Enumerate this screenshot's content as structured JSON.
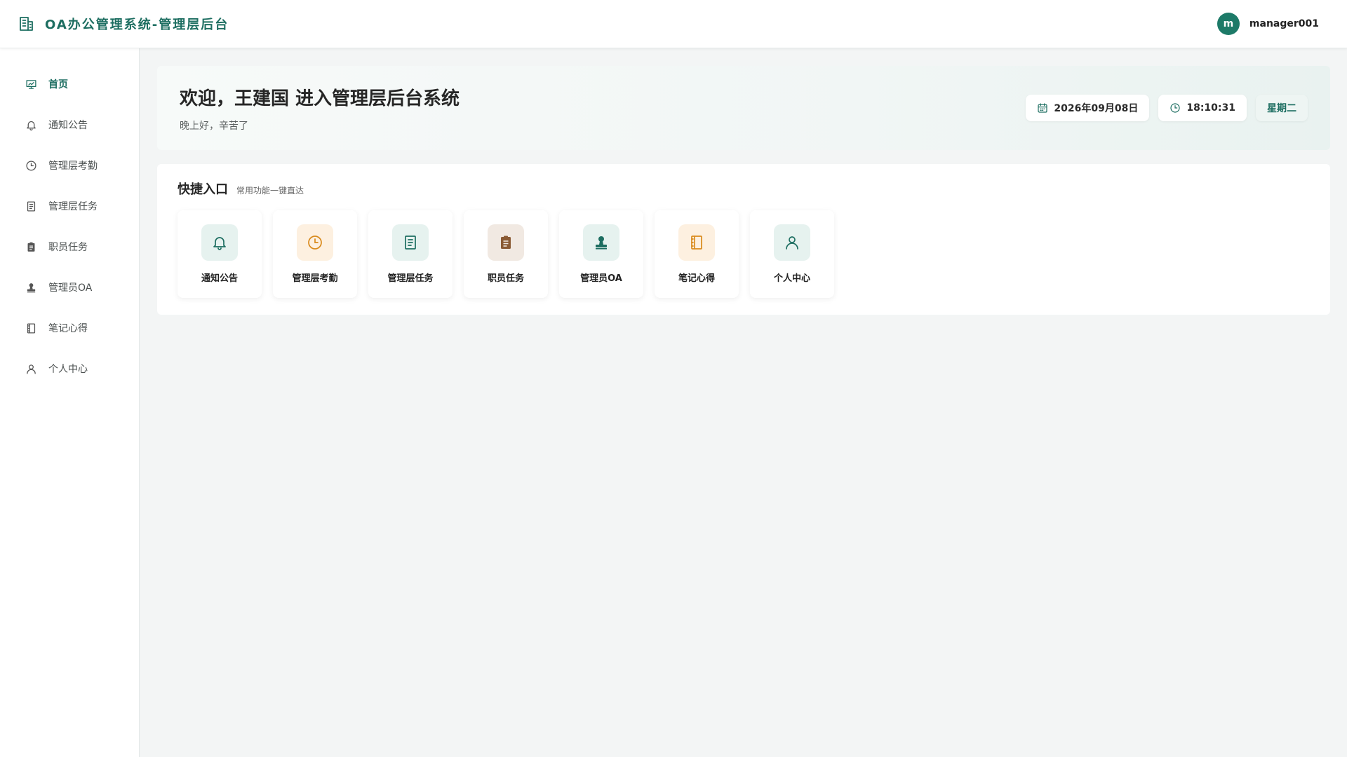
{
  "header": {
    "title": "OA办公管理系统-管理层后台",
    "logo_icon": "office-building-icon",
    "avatar_letter": "m",
    "username": "manager001"
  },
  "sidebar": {
    "items": [
      {
        "label": "首页",
        "icon": "dashboard-icon",
        "active": true
      },
      {
        "label": "通知公告",
        "icon": "bell-icon"
      },
      {
        "label": "管理层考勤",
        "icon": "clock-icon"
      },
      {
        "label": "管理层任务",
        "icon": "document-icon"
      },
      {
        "label": "职员任务",
        "icon": "clipboard-icon"
      },
      {
        "label": "管理员OA",
        "icon": "stamp-icon"
      },
      {
        "label": "笔记心得",
        "icon": "notebook-icon"
      },
      {
        "label": "个人中心",
        "icon": "user-icon"
      }
    ]
  },
  "welcome": {
    "title": "欢迎，王建国 进入管理层后台系统",
    "subtitle": "晚上好，辛苦了",
    "date": "2026年09月08日",
    "time": "18:10:31",
    "weekday": "星期二"
  },
  "quick": {
    "title": "快捷入口",
    "subtitle": "常用功能一键直达",
    "tiles": [
      {
        "label": "通知公告",
        "icon": "bell-icon"
      },
      {
        "label": "管理层考勤",
        "icon": "clock-icon"
      },
      {
        "label": "管理层任务",
        "icon": "document-icon"
      },
      {
        "label": "职员任务",
        "icon": "clipboard-icon"
      },
      {
        "label": "管理员OA",
        "icon": "stamp-icon"
      },
      {
        "label": "笔记心得",
        "icon": "notebook-icon"
      },
      {
        "label": "个人中心",
        "icon": "user-icon"
      }
    ]
  },
  "colors": {
    "brand": "#1d6e61",
    "accent_orange": "#d98a1c",
    "accent_brown": "#8a5a34"
  }
}
